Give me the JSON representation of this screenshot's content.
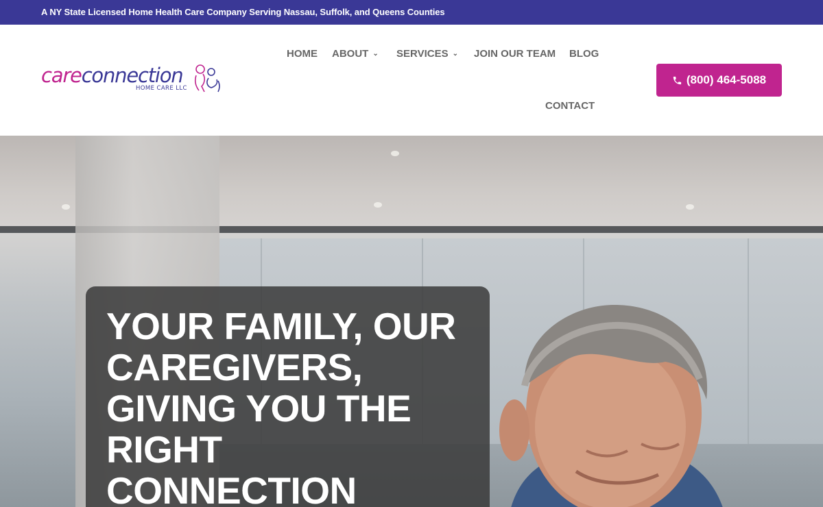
{
  "topbar": {
    "text": "A NY State Licensed Home Health Care Company Serving Nassau, Suffolk, and Queens Counties"
  },
  "logo": {
    "care": "care",
    "connection": "connection",
    "subtitle": "HOME CARE  LLC"
  },
  "nav": {
    "home": "HOME",
    "about": "ABOUT",
    "services": "SERVICES",
    "join": "JOIN OUR TEAM",
    "blog": "BLOG",
    "contact": "CONTACT"
  },
  "phone": {
    "label": "(800) 464-5088",
    "icon": "phone-icon"
  },
  "hero": {
    "headline": "YOUR FAMILY, OUR CAREGIVERS, GIVING YOU THE RIGHT CONNECTION"
  },
  "colors": {
    "brand_purple": "#3a3896",
    "brand_magenta": "#c0248f",
    "nav_text": "#666666"
  }
}
